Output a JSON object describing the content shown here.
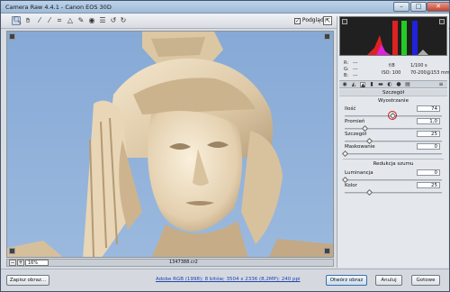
{
  "window": {
    "title": "Camera Raw 4.4.1  -  Canon EOS 30D"
  },
  "toolbar": {
    "tools": [
      "zoom-tool",
      "hand-tool",
      "white-balance-tool",
      "color-sampler-tool",
      "crop-tool",
      "straighten-tool",
      "retouch-tool",
      "red-eye-tool",
      "preferences",
      "rotate-left",
      "rotate-right"
    ],
    "preview_label": "Podgląd",
    "preview_checked": true
  },
  "preview_footer": {
    "zoom": "16%",
    "filename": "1347388.cr2"
  },
  "camera_info": {
    "r_label": "R:",
    "g_label": "G:",
    "b_label": "B:",
    "r_value": "---",
    "g_value": "---",
    "b_value": "---",
    "aperture": "f/8",
    "shutter": "1/100 s",
    "iso": "ISO: 100",
    "lens": "70-200@153 mm"
  },
  "panel": {
    "title": "Szczegół",
    "sharpening_title": "Wyostrzanie",
    "noise_title": "Redukcja szumu",
    "sharpening": [
      {
        "label": "Ilość",
        "value": "74",
        "level": 0.49
      },
      {
        "label": "Promień",
        "value": "1,0",
        "level": 0.2
      },
      {
        "label": "Szczegół",
        "value": "25",
        "level": 0.25
      },
      {
        "label": "Maskowanie",
        "value": "0",
        "level": 0.0
      }
    ],
    "noise": [
      {
        "label": "Luminancja",
        "value": "0",
        "level": 0.0
      },
      {
        "label": "Kolor",
        "value": "25",
        "level": 0.25
      }
    ]
  },
  "bottombar": {
    "save_label": "Zapisz obraz...",
    "workflow_link": "Adobe RGB (1998); 8 bitów; 3504 x 2336 (8,2MP); 240 ppi",
    "open_label": "Otwórz obraz",
    "cancel_label": "Anuluj",
    "done_label": "Gotowe"
  },
  "colors": {
    "sky": "#8fb0d8",
    "stone": "#e8d8bd",
    "accent": "#3d6fa8"
  }
}
